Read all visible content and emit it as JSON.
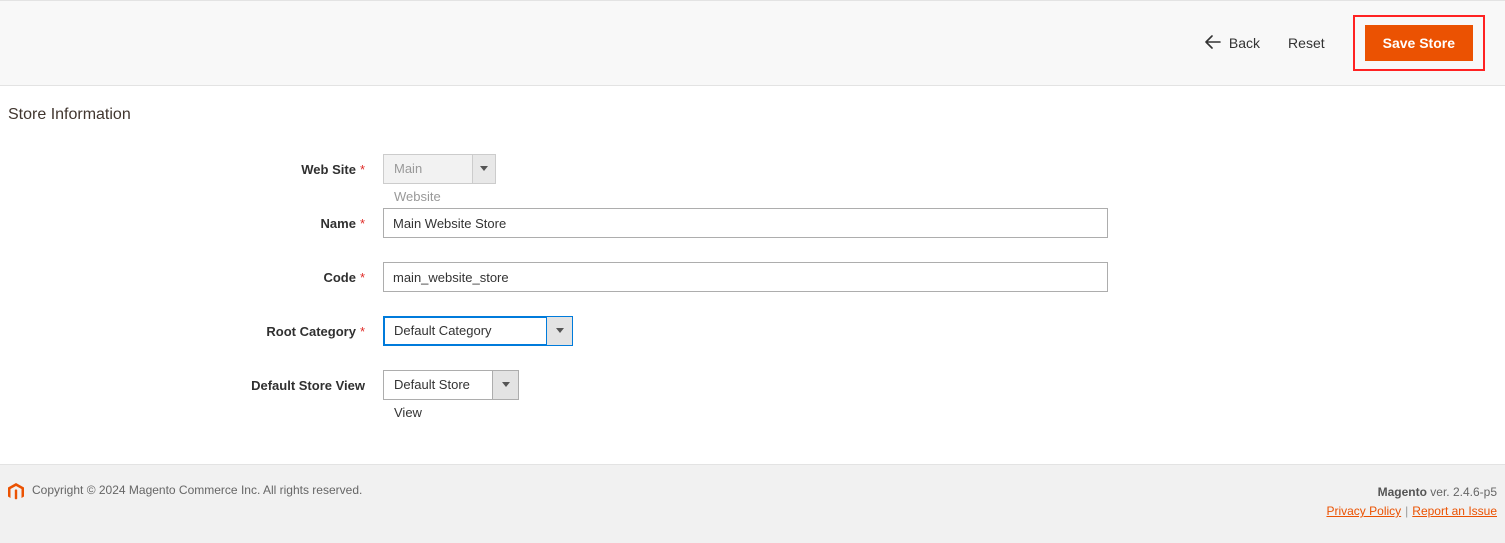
{
  "actions": {
    "back": "Back",
    "reset": "Reset",
    "save": "Save Store"
  },
  "section": {
    "title": "Store Information"
  },
  "form": {
    "website": {
      "label": "Web Site",
      "value": "Main Website",
      "required": true
    },
    "name": {
      "label": "Name",
      "value": "Main Website Store",
      "required": true
    },
    "code": {
      "label": "Code",
      "value": "main_website_store",
      "required": true
    },
    "root_category": {
      "label": "Root Category",
      "value": "Default Category",
      "required": true
    },
    "default_store_view": {
      "label": "Default Store View",
      "value": "Default Store View",
      "required": false
    }
  },
  "footer": {
    "copyright": "Copyright © 2024 Magento Commerce Inc. All rights reserved.",
    "product": "Magento",
    "version": " ver. 2.4.6-p5",
    "privacy": "Privacy Policy",
    "report": "Report an Issue"
  },
  "required_marker": "*"
}
